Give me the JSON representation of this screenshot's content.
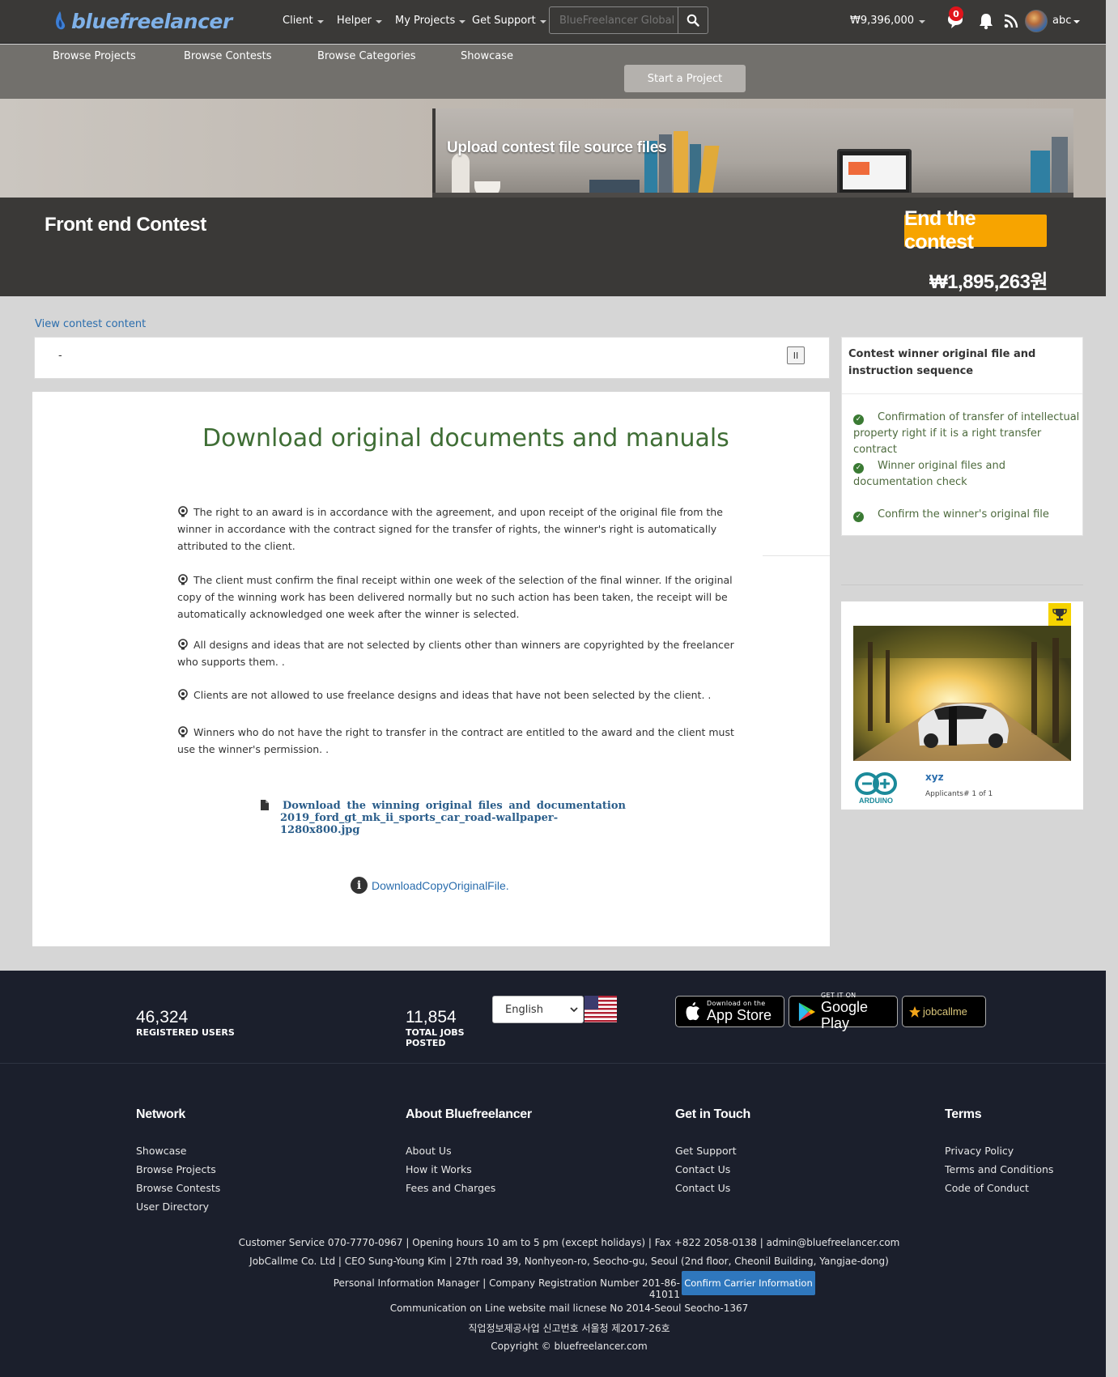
{
  "header": {
    "logo_text": "bluefreelancer",
    "nav": [
      {
        "label": "Client"
      },
      {
        "label": "Helper"
      },
      {
        "label": "My Projects"
      },
      {
        "label": "Get Support"
      }
    ],
    "search_placeholder": "BlueFreelancer Global",
    "balance": "₩9,396,000",
    "notification_count": "0",
    "username": "abc"
  },
  "subnav": {
    "items": [
      "Browse Projects",
      "Browse Contests",
      "Browse Categories",
      "Showcase"
    ],
    "start_button": "Start a Project"
  },
  "banner": {
    "title": "Upload contest file source files"
  },
  "contest": {
    "title": "Front end Contest",
    "end_button": "End the contest",
    "prize": "₩1,895,263원"
  },
  "content": {
    "view_link": "View contest content",
    "panel_value": "-",
    "pause_label": "II",
    "main_title": "Download original documents and manuals",
    "paragraphs": [
      "The right to an award is in accordance with the agreement, and upon receipt of the original file from the winner in accordance with the contract signed for the transfer of rights, the winner's right is automatically attributed to the client.",
      "The client must confirm the final receipt within one week of the selection of the final winner. If the original copy of the winning work has been delivered normally but no such action has been taken, the receipt will be automatically acknowledged one week after the winner is selected.",
      "All designs and ideas that are not selected by clients other than winners are copyrighted by the freelancer who supports them. .",
      "Clients are not allowed to use freelance designs and ideas that have not been selected by the client. .",
      "Winners who do not have the right to transfer in the contract are entitled to the award and the client must use the winner's permission. ."
    ],
    "download_words": [
      "Download",
      "the",
      "winning",
      "original",
      "files",
      "and",
      "documentation"
    ],
    "download_filename": "2019_ford_gt_mk_ii_sports_car_road-wallpaper-1280x800.jpg",
    "copy_link": "DownloadCopyOriginalFile.",
    "info_glyph": "i"
  },
  "sidebar": {
    "title": "Contest winner original file and instruction sequence",
    "steps": [
      "Confirmation of transfer of intellectual property right if it is a right transfer contract",
      "Winner original files and documentation check",
      "Confirm the winner's original file"
    ],
    "winner": {
      "name": "xyz",
      "applicants": "Applicants# 1 of 1",
      "logo_text": "ARDUINO"
    }
  },
  "footer": {
    "stats": [
      {
        "number": "46,324",
        "label": "REGISTERED USERS"
      },
      {
        "number": "11,854",
        "label": "TOTAL JOBS POSTED"
      }
    ],
    "language": "English",
    "stores": [
      {
        "small": "Download on the",
        "big": "App Store"
      },
      {
        "small": "GET IT ON",
        "big": "Google Play"
      },
      {
        "small": "jobcallme",
        "big": ""
      }
    ],
    "columns": [
      {
        "heading": "Network",
        "links": [
          "Showcase",
          "Browse Projects",
          "Browse Contests",
          "User Directory"
        ]
      },
      {
        "heading": "About Bluefreelancer",
        "links": [
          "About Us",
          "How it Works",
          "Fees and Charges"
        ]
      },
      {
        "heading": "Get in Touch",
        "links": [
          "Get Support",
          "Contact Us",
          "Contact Us"
        ]
      },
      {
        "heading": "Terms",
        "links": [
          "Privacy Policy",
          "Terms and Conditions",
          "Code of Conduct"
        ]
      }
    ],
    "info_lines": [
      "Customer Service 070-7770-0967 | Opening hours 10 am to 5 pm (except holidays) | Fax +822 2058-0138 | admin@bluefreelancer.com",
      "JobCallme Co. Ltd | CEO Sung-Young Kim | 27th road 39, Nonhyeon-ro, Seocho-gu, Seoul (2nd floor, Cheonil Building, Yangjae-dong)",
      "Personal Information Manager | Company Registration Number 201-86-41011",
      "Communication on Line website mail licnese No 2014-Seoul Seocho-1367",
      "직업정보제공사업 신고번호 서울청 제2017-26호",
      "Copyright © bluefreelancer.com"
    ],
    "carrier_button": "Confirm Carrier Information"
  },
  "colors": {
    "nav_bg": "#3a3937",
    "subnav_bg": "#72706c",
    "accent_orange": "#f7a400",
    "link_blue": "#2a6dad",
    "title_green": "#3f6e35",
    "footer_bg": "#1b1f2c"
  }
}
